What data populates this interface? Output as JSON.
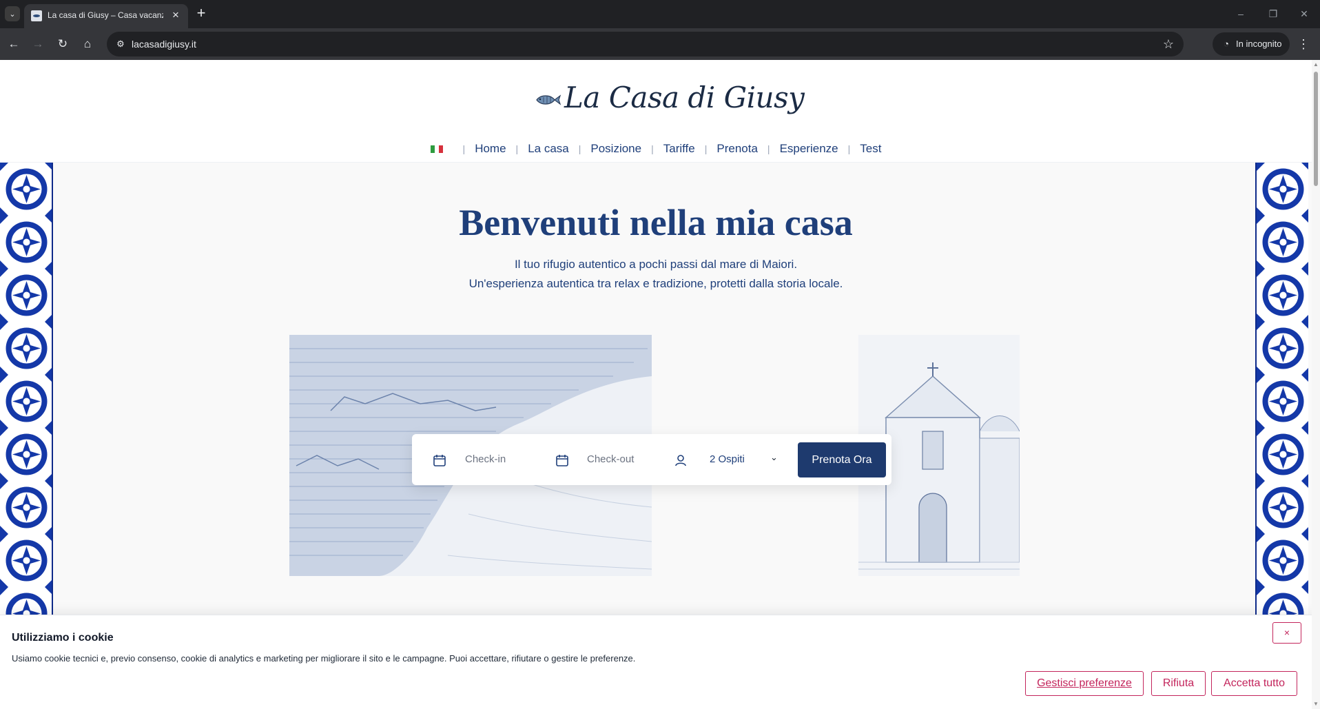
{
  "browser": {
    "tab_title": "La casa di Giusy – Casa vacanze",
    "tab_list_icon": "chevron-down-icon",
    "new_tab_symbol": "+",
    "close_tab_symbol": "×",
    "url": "lacasadigiusy.it",
    "incognito_label": "In incognito",
    "controls": {
      "minimize": "–",
      "restore": "❐",
      "close": "✕"
    }
  },
  "site": {
    "logo_text": "La Casa di Giusy",
    "nav": {
      "language_flag_colors": [
        "#2e9c3f",
        "#ffffff",
        "#d6313c"
      ],
      "items": [
        "Home",
        "La casa",
        "Posizione",
        "Tariffe",
        "Prenota",
        "Esperienze",
        "Test"
      ]
    },
    "hero": {
      "title": "Benvenuti nella mia casa",
      "subtitle_line1": "Il tuo rifugio autentico a pochi passi dal mare di Maiori.",
      "subtitle_line2": "Un'esperienza autentica tra relax e tradizione, protetti dalla storia locale."
    },
    "booking": {
      "checkin_placeholder": "Check-in",
      "checkout_placeholder": "Check-out",
      "guests_selected": "2 Ospiti",
      "submit_label": "Prenota Ora"
    },
    "cookie_banner": {
      "title": "Utilizziamo i cookie",
      "text": "Usiamo cookie tecnici e, previo consenso, cookie di analytics e marketing per migliorare il sito e le campagne. Puoi accettare, rifiutare o gestire le preferenze.",
      "close_symbol": "×",
      "manage_label": "Gestisci preferenze",
      "reject_label": "Rifiuta",
      "accept_label": "Accetta tutto"
    }
  },
  "colors": {
    "brand_blue": "#1f3f7a",
    "button_blue": "#1e3a6e",
    "cookie_accent": "#c3245b",
    "tile_blue": "#0e2a8a"
  }
}
